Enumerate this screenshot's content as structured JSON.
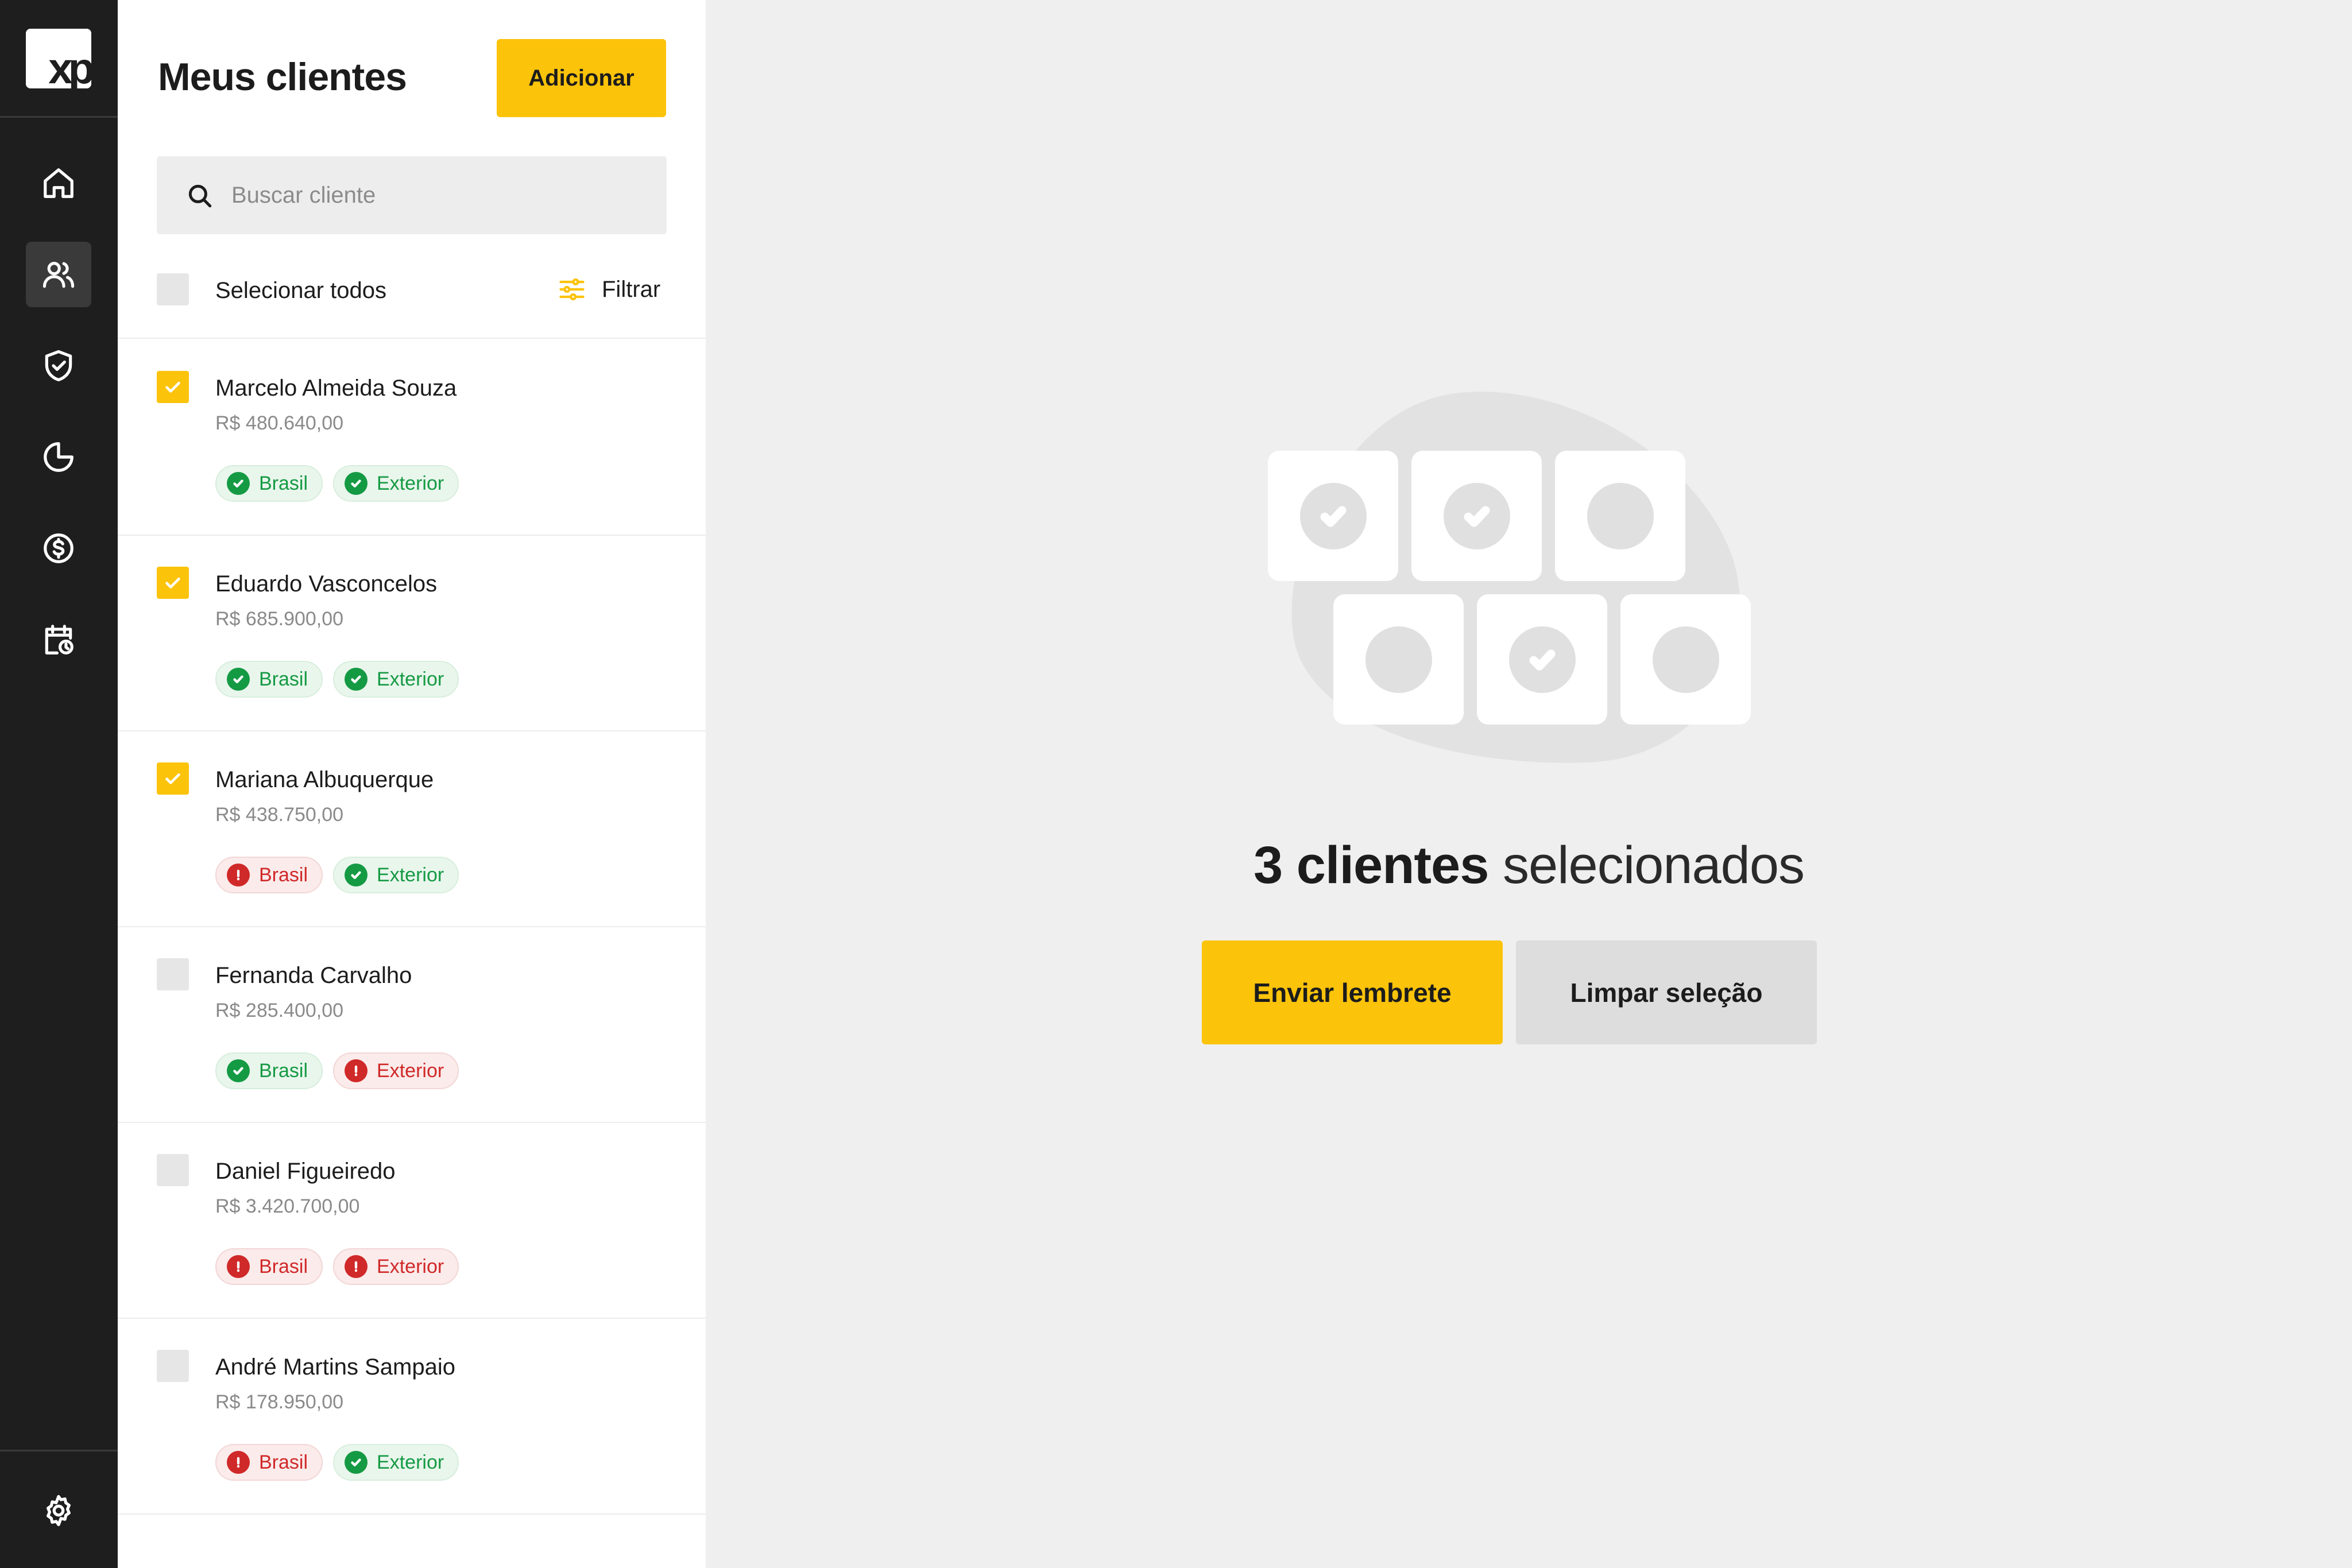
{
  "brand": {
    "logo_text": "xp",
    "accent": "#fbc30a",
    "ok_color": "#159a44",
    "err_color": "#d02929"
  },
  "rail": {
    "items": [
      {
        "icon": "home-icon",
        "active": false
      },
      {
        "icon": "users-icon",
        "active": true
      },
      {
        "icon": "shield-check-icon",
        "active": false
      },
      {
        "icon": "pie-chart-icon",
        "active": false
      },
      {
        "icon": "dollar-circle-icon",
        "active": false
      },
      {
        "icon": "calendar-clock-icon",
        "active": false
      }
    ],
    "bottom": {
      "icon": "gear-icon"
    }
  },
  "list": {
    "title": "Meus clientes",
    "add_label": "Adicionar",
    "search_placeholder": "Buscar cliente",
    "select_all_label": "Selecionar todos",
    "filter_label": "Filtrar",
    "clients": [
      {
        "name": "Marcelo Almeida Souza",
        "value": "R$ 480.640,00",
        "checked": true,
        "tags": [
          {
            "label": "Brasil",
            "status": "ok"
          },
          {
            "label": "Exterior",
            "status": "ok"
          }
        ]
      },
      {
        "name": "Eduardo Vasconcelos",
        "value": "R$ 685.900,00",
        "checked": true,
        "tags": [
          {
            "label": "Brasil",
            "status": "ok"
          },
          {
            "label": "Exterior",
            "status": "ok"
          }
        ]
      },
      {
        "name": "Mariana Albuquerque",
        "value": "R$ 438.750,00",
        "checked": true,
        "tags": [
          {
            "label": "Brasil",
            "status": "err"
          },
          {
            "label": "Exterior",
            "status": "ok"
          }
        ]
      },
      {
        "name": "Fernanda Carvalho",
        "value": "R$ 285.400,00",
        "checked": false,
        "tags": [
          {
            "label": "Brasil",
            "status": "ok"
          },
          {
            "label": "Exterior",
            "status": "err"
          }
        ]
      },
      {
        "name": "Daniel Figueiredo",
        "value": "R$ 3.420.700,00",
        "checked": false,
        "tags": [
          {
            "label": "Brasil",
            "status": "err"
          },
          {
            "label": "Exterior",
            "status": "err"
          }
        ]
      },
      {
        "name": "André Martins Sampaio",
        "value": "R$ 178.950,00",
        "checked": false,
        "tags": [
          {
            "label": "Brasil",
            "status": "err"
          },
          {
            "label": "Exterior",
            "status": "ok"
          }
        ]
      }
    ]
  },
  "selection": {
    "count_text": "3 clientes",
    "suffix_text": "selecionados",
    "send_label": "Enviar lembrete",
    "clear_label": "Limpar seleção"
  }
}
